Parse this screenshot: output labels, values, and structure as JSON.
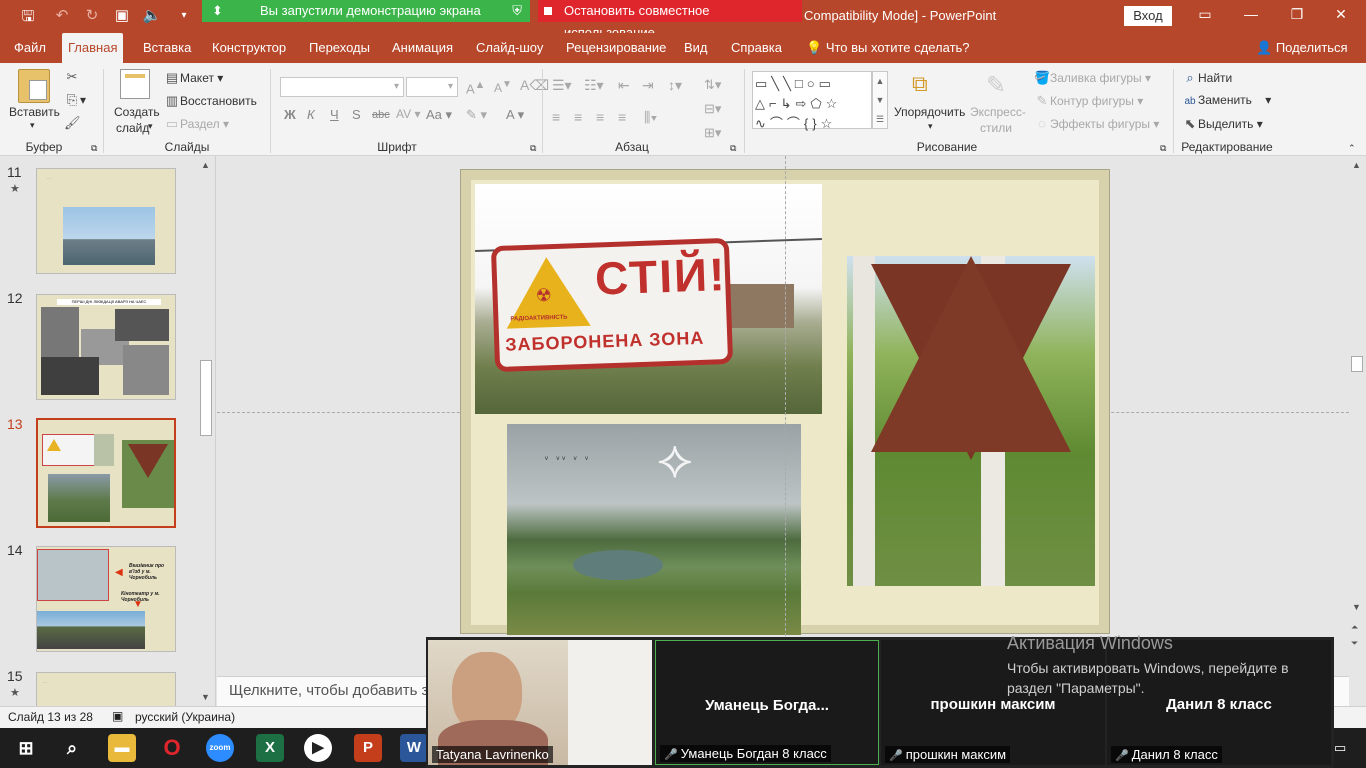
{
  "titlebar": {
    "share_status": "Вы запустили демонстрацию экрана",
    "stop_share": "Остановить совместное использование",
    "doc_title": "Compatibility Mode]  -  PowerPoint",
    "signin": "Вход"
  },
  "tabs": [
    "Файл",
    "Главная",
    "Вставка",
    "Конструктор",
    "Переходы",
    "Анимация",
    "Слайд-шоу",
    "Рецензирование",
    "Вид",
    "Справка"
  ],
  "tell_me": "Что вы хотите сделать?",
  "share_label": "Поделиться",
  "ribbon": {
    "clipboard": {
      "label": "Буфер обмена",
      "paste": "Вставить"
    },
    "slides": {
      "label": "Слайды",
      "new_slide_1": "Создать",
      "new_slide_2": "слайд",
      "layout": "Макет",
      "reset": "Восстановить",
      "section": "Раздел"
    },
    "font": {
      "label": "Шрифт",
      "bold": "Ж",
      "italic": "К",
      "underline": "Ч",
      "shadow": "S",
      "strike": "abc",
      "case": "Aa",
      "color": "A"
    },
    "paragraph": {
      "label": "Абзац"
    },
    "drawing": {
      "label": "Рисование",
      "arrange": "Упорядочить",
      "quick_styles_1": "Экспресс-",
      "quick_styles_2": "стили",
      "fill": "Заливка фигуры",
      "outline": "Контур фигуры",
      "effects": "Эффекты фигуры"
    },
    "editing": {
      "label": "Редактирование",
      "find": "Найти",
      "replace": "Заменить",
      "select": "Выделить"
    }
  },
  "thumbnails": [
    {
      "num": "11",
      "star": "★",
      "text": "…"
    },
    {
      "num": "12",
      "title": "ПЕРШІ ДНІ ЛІКВІДАЦІЇ АВАРІЇ НА ЧАЕС"
    },
    {
      "num": "13"
    },
    {
      "num": "14",
      "caption_1": "Вказівник про в'їзд у м. Чорнобиль",
      "caption_2": "Кінотеатр у м. Чорнобиль"
    },
    {
      "num": "15",
      "star": "★",
      "text": "…"
    }
  ],
  "slide": {
    "sign_word": "СТІЙ!",
    "sign_zone": "ЗАБОРОНЕНА ЗОНА",
    "sign_small": "РАДІОАКТИВНІСТЬ"
  },
  "notes_placeholder": "Щелкните, чтобы добавить за",
  "status": {
    "slide": "Слайд 13 из 28",
    "lang": "русский (Украина)"
  },
  "zoom": {
    "participants": [
      {
        "label": "Tatyana Lavrinenko"
      },
      {
        "name": "Уманець  Богда...",
        "label": "Уманець Богдан 8 класс"
      },
      {
        "name": "прошкин максим",
        "label": "прошкин максим"
      },
      {
        "name": "Данил 8 класс",
        "label": "Данил 8 класс"
      }
    ]
  },
  "activation": {
    "title": "Активация Windows",
    "line1": "Чтобы активировать Windows, перейдите в",
    "line2": "раздел \"Параметры\"."
  }
}
